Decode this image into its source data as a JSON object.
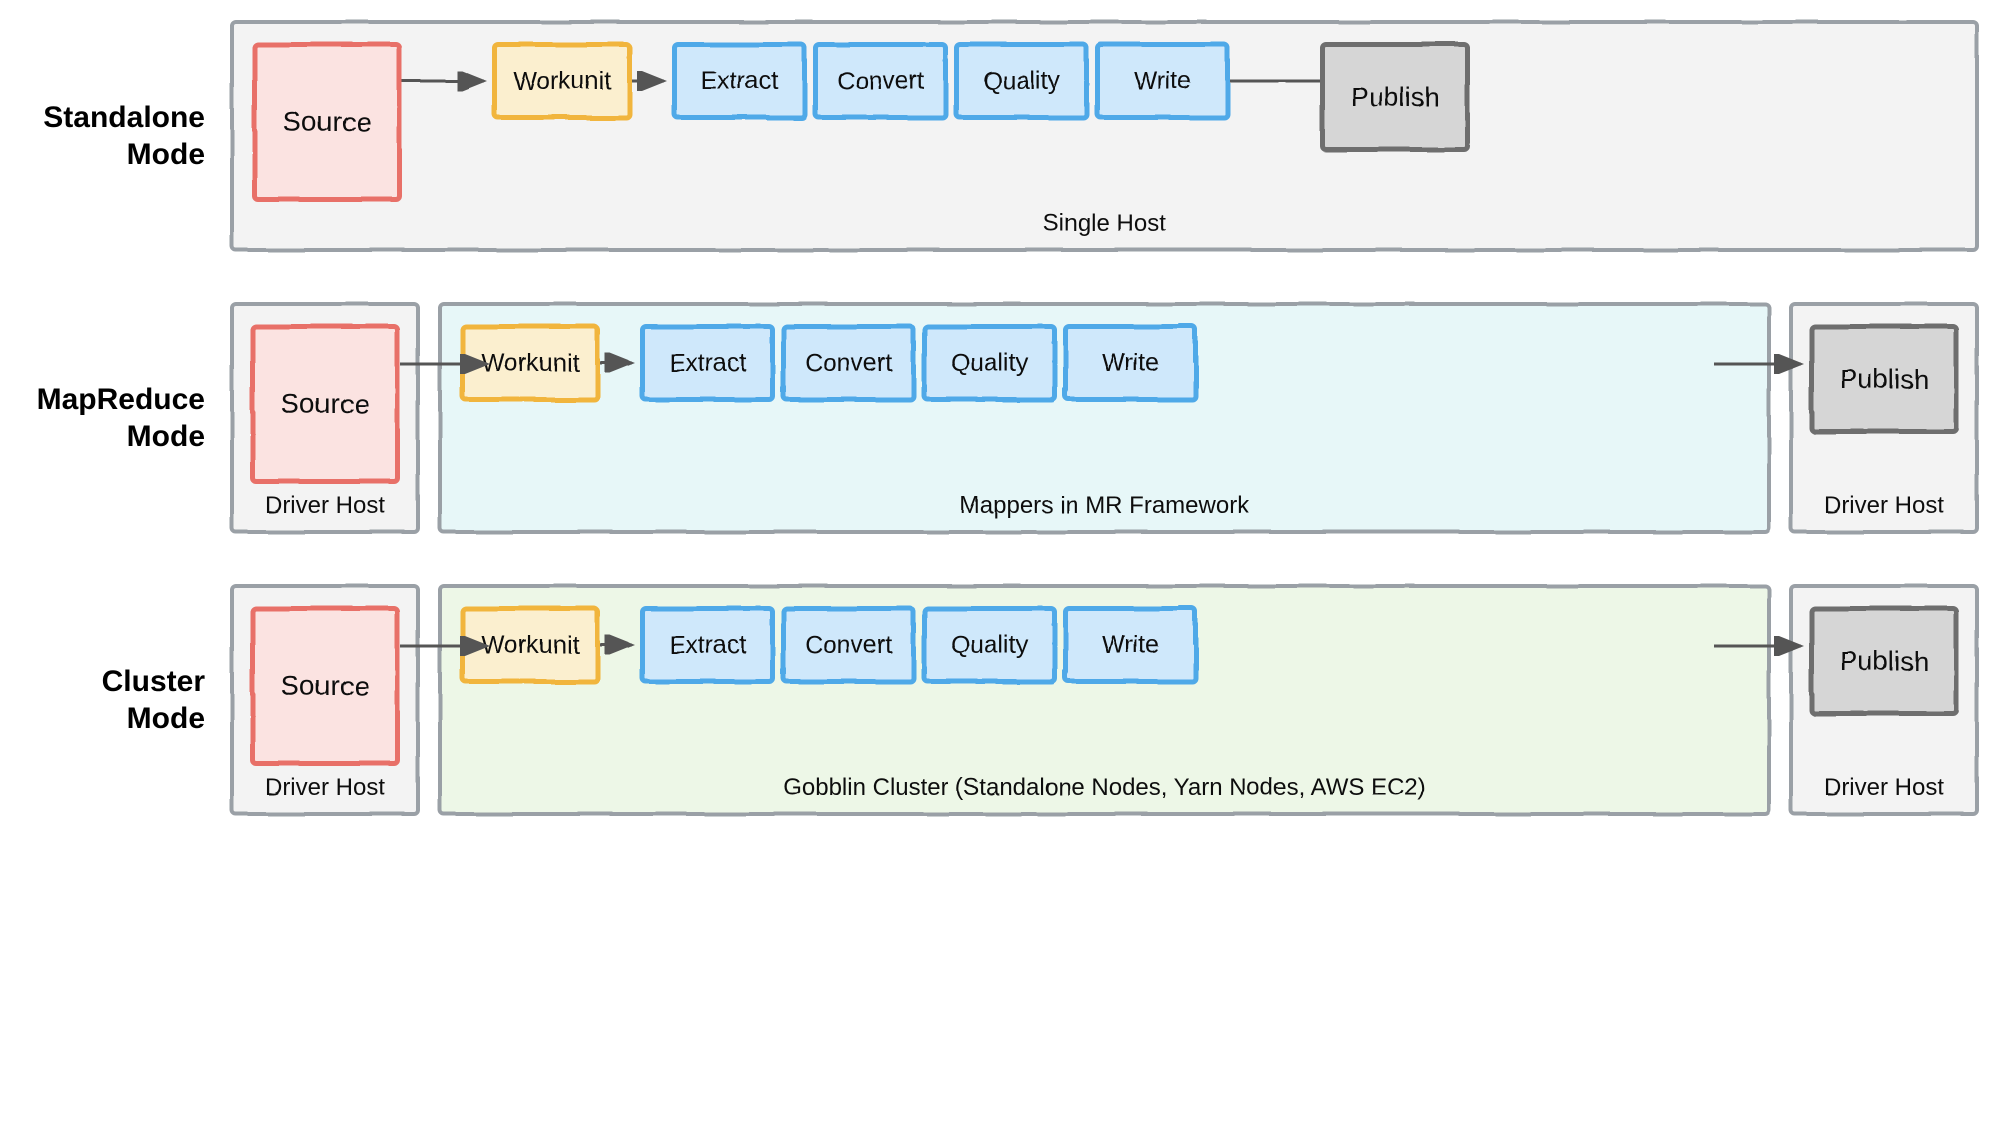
{
  "modes": {
    "standalone": {
      "label": "Standalone Mode",
      "containers": {
        "single": "Single Host"
      },
      "nodes": {
        "source": "Source",
        "workunit": "Workunit",
        "stages": [
          "Extract",
          "Convert",
          "Quality",
          "Write"
        ],
        "publish": "Publish"
      }
    },
    "mapreduce": {
      "label": "MapReduce Mode",
      "containers": {
        "left": "Driver Host",
        "middle": "Mappers in MR Framework",
        "right": "Driver Host"
      },
      "nodes": {
        "source": "Source",
        "workunit": "Workunit",
        "stages": [
          "Extract",
          "Convert",
          "Quality",
          "Write"
        ],
        "publish": "Publish"
      }
    },
    "cluster": {
      "label": "Cluster Mode",
      "containers": {
        "left": "Driver Host",
        "middle": "Gobblin Cluster (Standalone Nodes, Yarn Nodes, AWS EC2)",
        "right": "Driver Host"
      },
      "nodes": {
        "source": "Source",
        "workunit": "Workunit",
        "stages": [
          "Extract",
          "Convert",
          "Quality",
          "Write"
        ],
        "publish": "Publish"
      }
    }
  },
  "colors": {
    "source_border": "#e86f67",
    "source_fill": "#fbe3e1",
    "workunit_border": "#f1b53e",
    "workunit_fill": "#fbefcf",
    "stage_border": "#4fa9e8",
    "stage_fill": "#cfe8fb",
    "publish_border": "#6e6e6e",
    "publish_fill": "#d6d6d6",
    "container_border": "#9aa0a6",
    "container_fill_default": "#f3f3f3",
    "container_fill_mappers": "#e7f7f8",
    "container_fill_cluster": "#edf7e7",
    "arrow": "#555555"
  }
}
